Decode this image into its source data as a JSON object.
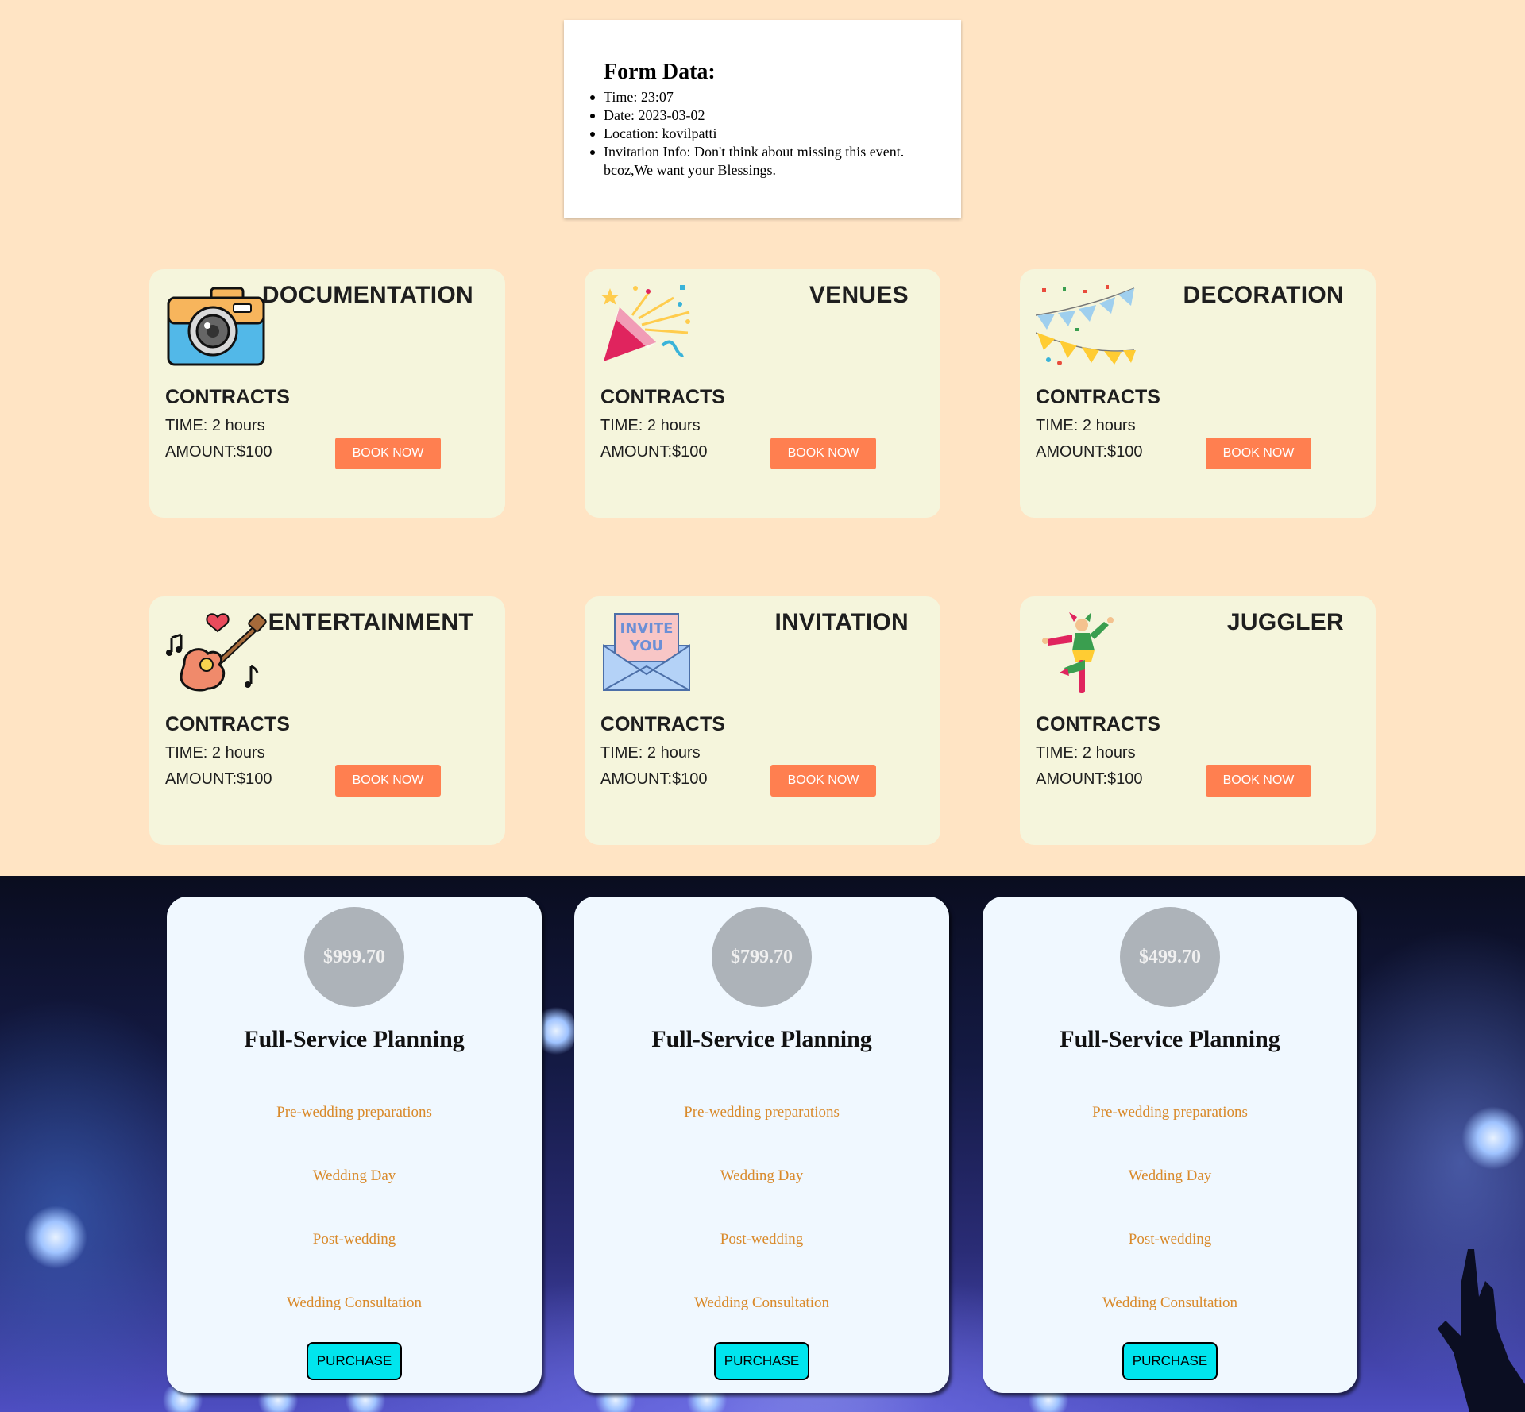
{
  "form": {
    "heading": "Form Data:",
    "items": [
      "Time: 23:07",
      "Date: 2023-03-02",
      "Location: kovilpatti",
      "Invitation Info: Don't think about missing this event. bcoz,We want your Blessings."
    ]
  },
  "services": [
    {
      "title": "DOCUMENTATION",
      "icon": "camera-icon",
      "contracts": "CONTRACTS",
      "time": "TIME: 2 hours",
      "amount": "AMOUNT:$100",
      "button": "BOOK NOW"
    },
    {
      "title": "VENUES",
      "icon": "party-popper-icon",
      "contracts": "CONTRACTS",
      "time": "TIME: 2 hours",
      "amount": "AMOUNT:$100",
      "button": "BOOK NOW"
    },
    {
      "title": "DECORATION",
      "icon": "bunting-flags-icon",
      "contracts": "CONTRACTS",
      "time": "TIME: 2 hours",
      "amount": "AMOUNT:$100",
      "button": "BOOK NOW"
    },
    {
      "title": "ENTERTAINMENT",
      "icon": "guitar-icon",
      "contracts": "CONTRACTS",
      "time": "TIME: 2 hours",
      "amount": "AMOUNT:$100",
      "button": "BOOK NOW"
    },
    {
      "title": "INVITATION",
      "icon": "invite-envelope-icon",
      "contracts": "CONTRACTS",
      "time": "TIME: 2 hours",
      "amount": "AMOUNT:$100",
      "button": "BOOK NOW"
    },
    {
      "title": "JUGGLER",
      "icon": "jester-icon",
      "contracts": "CONTRACTS",
      "time": "TIME: 2 hours",
      "amount": "AMOUNT:$100",
      "button": "BOOK NOW"
    }
  ],
  "plans": [
    {
      "price": "$999.70",
      "title": "Full-Service Planning",
      "features": [
        "Pre-wedding preparations",
        "Wedding Day",
        "Post-wedding",
        "Wedding Consultation"
      ],
      "button": "PURCHASE"
    },
    {
      "price": "$799.70",
      "title": "Full-Service Planning",
      "features": [
        "Pre-wedding preparations",
        "Wedding Day",
        "Post-wedding",
        "Wedding Consultation"
      ],
      "button": "PURCHASE"
    },
    {
      "price": "$499.70",
      "title": "Full-Service Planning",
      "features": [
        "Pre-wedding preparations",
        "Wedding Day",
        "Post-wedding",
        "Wedding Consultation"
      ],
      "button": "PURCHASE"
    }
  ],
  "colors": {
    "page_bg": "#ffe4c4",
    "card_bg": "#f5f5dc",
    "book_button": "#ff7f50",
    "price_circle": "#adb3b9",
    "feature_text": "#d98a2b",
    "purchase_button": "#00e5ee"
  }
}
